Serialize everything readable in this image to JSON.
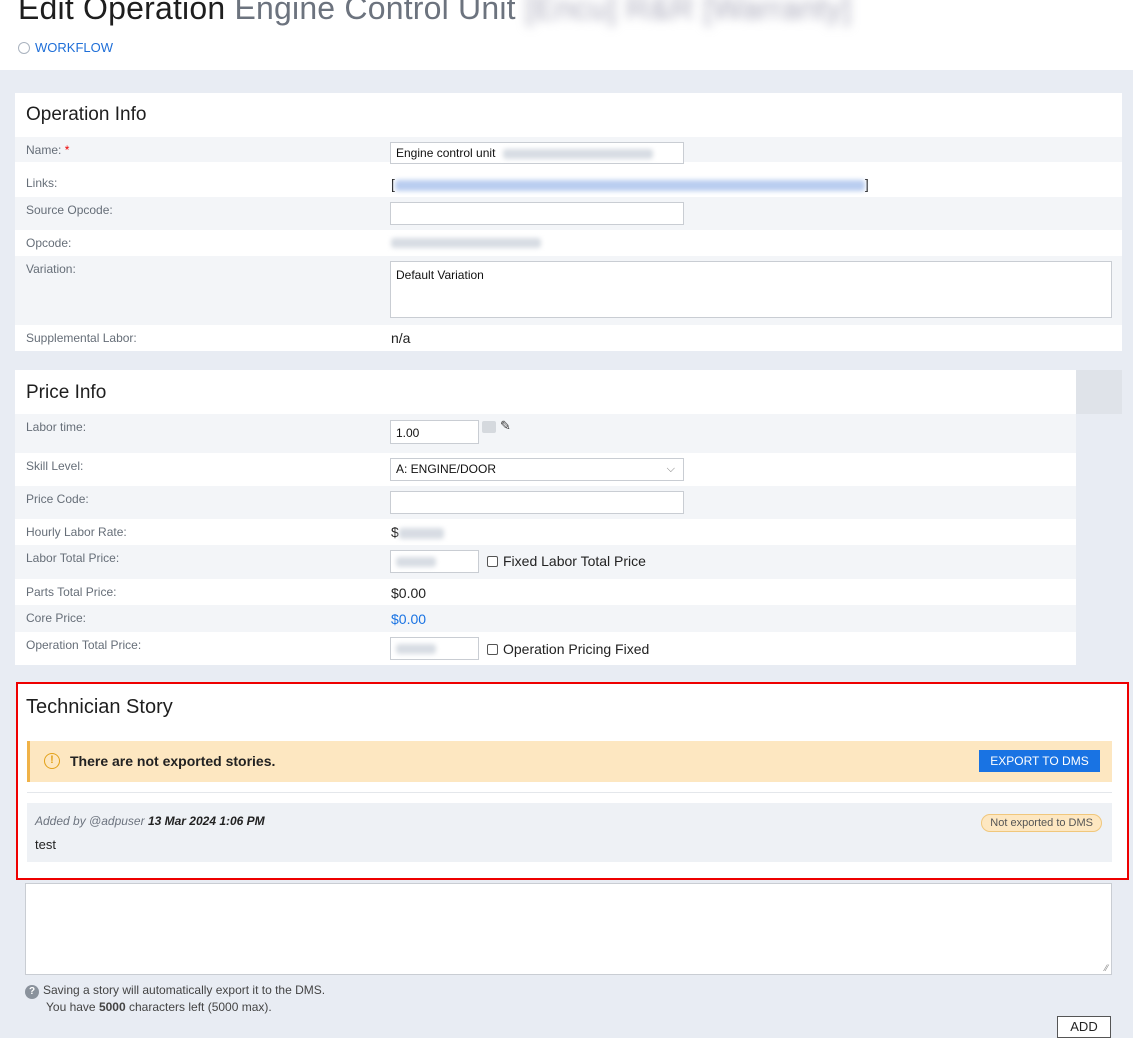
{
  "header": {
    "title_main": "Edit Operation",
    "title_sub": "Engine Control Unit",
    "title_redacted": "[Encu] R&R [Warranty]",
    "workflow_label": "WORKFLOW"
  },
  "operation_info": {
    "title": "Operation Info",
    "name_label": "Name:",
    "required_mark": "*",
    "name_value": "Engine control unit",
    "links_label": "Links:",
    "links_open": "[",
    "links_close": "]",
    "source_opcode_label": "Source Opcode:",
    "source_opcode_value": "",
    "opcode_label": "Opcode:",
    "variation_label": "Variation:",
    "variation_value": "Default Variation",
    "supplemental_label": "Supplemental Labor:",
    "supplemental_value": "n/a"
  },
  "price_info": {
    "title": "Price Info",
    "labor_time_label": "Labor time:",
    "labor_time_value": "1.00",
    "skill_label": "Skill Level:",
    "skill_value": "A: ENGINE/DOOR",
    "price_code_label": "Price Code:",
    "price_code_value": "",
    "hourly_label": "Hourly Labor Rate:",
    "hourly_prefix": "$",
    "labor_total_label": "Labor Total Price:",
    "fixed_labor_label": "Fixed Labor Total Price",
    "parts_label": "Parts Total Price:",
    "parts_value": "$0.00",
    "core_label": "Core Price:",
    "core_value": "$0.00",
    "op_total_label": "Operation Total Price:",
    "op_pricing_label": "Operation Pricing Fixed"
  },
  "tech_story": {
    "title": "Technician Story",
    "alert_text": "There are not exported stories.",
    "export_button": "EXPORT TO DMS",
    "story_added_by": "Added by @adpuser",
    "story_date": "13 Mar 2024 1:06 PM",
    "story_text": "test",
    "story_badge": "Not exported to DMS",
    "help_line1": "Saving a story will automatically export it to the DMS.",
    "help_line2_pre": "You have",
    "help_line2_count": "5000",
    "help_line2_post": "characters left (5000 max).",
    "add_button": "ADD"
  },
  "colors": {
    "accent": "#1973e3",
    "warning_bg": "#fde7c1",
    "highlight_border": "#ee0000"
  }
}
